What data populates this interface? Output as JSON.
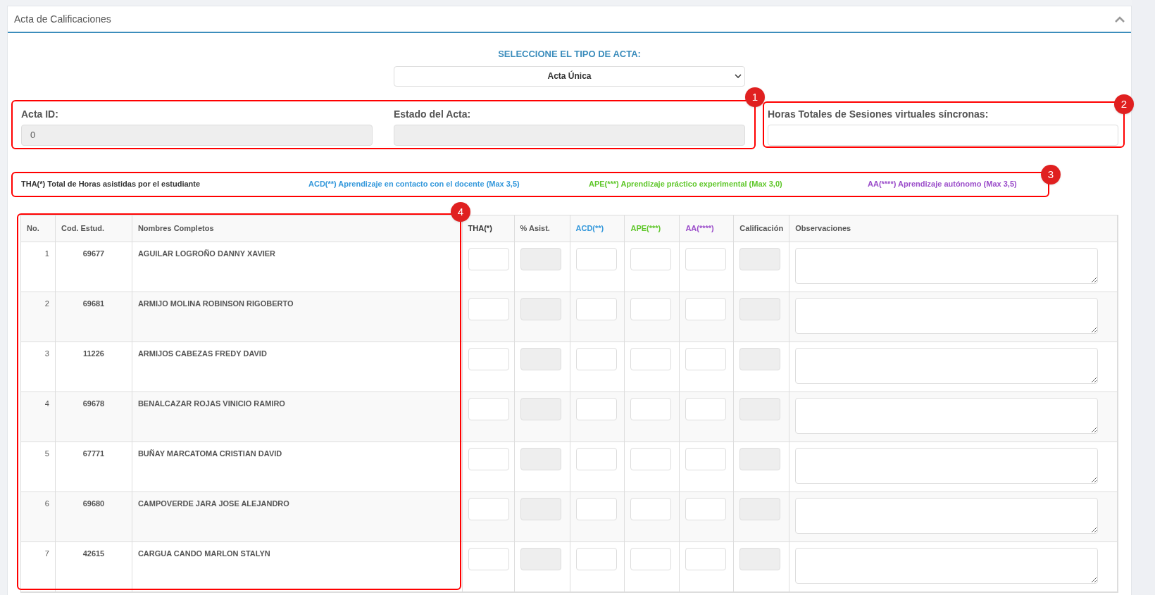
{
  "panel": {
    "title": "Acta de Calificaciones",
    "expanded": true
  },
  "acta_type": {
    "label": "SELECCIONE EL TIPO DE ACTA:",
    "value": "Acta Única"
  },
  "fields": [
    {
      "label": "Acta ID:",
      "value": "0",
      "disabled": true
    },
    {
      "label": "Estado del Acta:",
      "disabled": true
    },
    {
      "label": "Horas Totales de Sesiones virtuales síncronas:",
      "disabled": false
    }
  ],
  "legend": [
    {
      "text": "THA(*) Total de Horas asistidas por el estudiante",
      "color": "#333333"
    },
    {
      "text": "ACD(**) Aprendizaje en contacto con el docente (Max 3,5)",
      "color": "#3498db"
    },
    {
      "text": "APE(***) Aprendizaje práctico experimental (Max 3,0)",
      "color": "#5fc72a"
    },
    {
      "text": "AA(****) Aprendizaje autónomo (Max 3,5)",
      "color": "#9b4dca"
    }
  ],
  "table": {
    "columns": [
      {
        "label": "No.",
        "kind": "number",
        "color": "#555555"
      },
      {
        "label": "Cod. Estud.",
        "kind": "code",
        "color": "#555555"
      },
      {
        "label": "Nombres Completos",
        "kind": "name",
        "color": "#555555"
      },
      {
        "label": "THA(*)",
        "kind": "input",
        "color": "#333333"
      },
      {
        "label": "% Asist.",
        "kind": "readonly",
        "color": "#555555"
      },
      {
        "label": "ACD(**)",
        "kind": "input",
        "color": "#3498db"
      },
      {
        "label": "APE(***)",
        "kind": "input",
        "color": "#5fc72a"
      },
      {
        "label": "AA(****)",
        "kind": "input",
        "color": "#9b4dca"
      },
      {
        "label": "Calificación",
        "kind": "readonly",
        "color": "#555555"
      },
      {
        "label": "Observaciones",
        "kind": "textarea",
        "color": "#555555"
      }
    ],
    "rows": [
      {
        "no": "1",
        "code": "69677",
        "name": "AGUILAR LOGROÑO DANNY XAVIER"
      },
      {
        "no": "2",
        "code": "69681",
        "name": "ARMIJO MOLINA ROBINSON RIGOBERTO"
      },
      {
        "no": "3",
        "code": "11226",
        "name": "ARMIJOS CABEZAS FREDY DAVID"
      },
      {
        "no": "4",
        "code": "69678",
        "name": "BENALCAZAR ROJAS VINICIO RAMIRO"
      },
      {
        "no": "5",
        "code": "67771",
        "name": "BUÑAY MARCATOMA CRISTIAN DAVID"
      },
      {
        "no": "6",
        "code": "69680",
        "name": "CAMPOVERDE JARA JOSE ALEJANDRO"
      },
      {
        "no": "7",
        "code": "42615",
        "name": "CARGUA CANDO MARLON STALYN"
      }
    ]
  },
  "annotations": [
    "1",
    "2",
    "3",
    "4"
  ]
}
